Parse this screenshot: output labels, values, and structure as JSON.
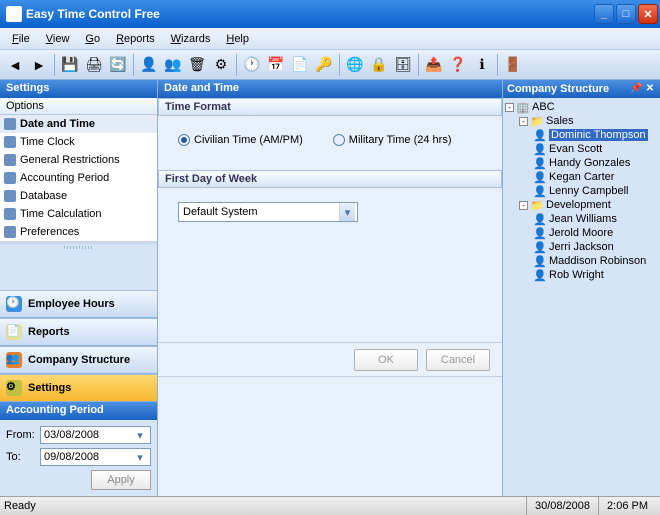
{
  "window": {
    "title": "Easy Time Control Free"
  },
  "menu": {
    "file": "File",
    "view": "View",
    "go": "Go",
    "reports": "Reports",
    "wizards": "Wizards",
    "help": "Help"
  },
  "left": {
    "settings_title": "Settings",
    "options_label": "Options",
    "items": [
      "Date and Time",
      "Time Clock",
      "General Restrictions",
      "Accounting Period",
      "Database",
      "Time Calculation",
      "Preferences"
    ],
    "nav": {
      "emp": "Employee Hours",
      "rep": "Reports",
      "comp": "Company Structure",
      "set": "Settings"
    },
    "period_title": "Accounting Period",
    "from_label": "From:",
    "to_label": "To:",
    "from_value": "03/08/2008",
    "to_value": "09/08/2008",
    "apply": "Apply"
  },
  "center": {
    "title": "Date and Time",
    "time_format": "Time Format",
    "civilian": "Civilian Time  (AM/PM)",
    "military": "Military Time (24 hrs)",
    "first_day": "First Day of Week",
    "combo_value": "Default System",
    "ok": "OK",
    "cancel": "Cancel"
  },
  "right": {
    "title": "Company Structure",
    "root": "ABC",
    "group1": "Sales",
    "g1": [
      "Dominic Thompson",
      "Evan Scott",
      "Handy Gonzales",
      "Kegan Carter",
      "Lenny Campbell"
    ],
    "group2": "Development",
    "g2": [
      "Jean Williams",
      "Jerold Moore",
      "Jerri Jackson",
      "Maddison Robinson",
      "Rob Wright"
    ]
  },
  "status": {
    "ready": "Ready",
    "date": "30/08/2008",
    "time": "2:06 PM"
  }
}
